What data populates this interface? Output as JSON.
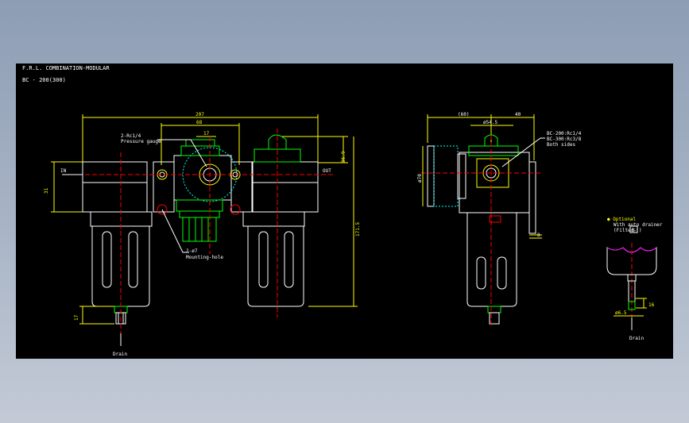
{
  "drawing": {
    "title": "F.R.L. COMBINATION-MODULAR",
    "model": "BC - 200(300)"
  },
  "front_view": {
    "dim_width": "207",
    "dim_center": "68",
    "dim_small": "17",
    "dim_top_right": "36.9",
    "dim_left": "31",
    "dim_height": "171.5",
    "dim_bottom": "17",
    "port_in": "IN",
    "port_out": "OUT",
    "callout_gauge_port": "2-Rc1/4",
    "callout_gauge": "Pressure gauge",
    "callout_hole_size": "2-ø7",
    "callout_hole": "Mounting-hole",
    "drain": "Drain"
  },
  "side_view": {
    "dim_left": "(60)",
    "dim_right": "40",
    "dim_center": "ø54.5",
    "dim_diameter": "ø70",
    "dim_step": "8",
    "callout_line1": "BC-200:Rc1/4",
    "callout_line2": "BC-300:Rc3/8",
    "callout_line3": "Both sides"
  },
  "detail_view": {
    "bullet": "● Optional",
    "line1": "With auto drainer",
    "line2": "(Filter-",
    "box_text": "B",
    "line2_end": ")",
    "dim_small": "16",
    "dim_bottom": "ø6.5",
    "drain": "Drain"
  },
  "colors": {
    "background": "#000000",
    "outline": "#ffffff",
    "dimension": "#ffff00",
    "centerline": "#ff0000",
    "component": "#00ff00",
    "magenta": "#ff00ff",
    "cyan": "#00ffff"
  }
}
